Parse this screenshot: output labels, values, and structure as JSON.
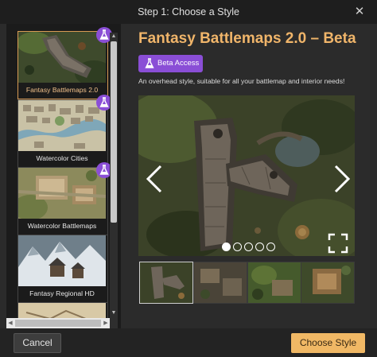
{
  "window": {
    "title": "Step 1: Choose a Style",
    "close_label": "✕"
  },
  "styles": [
    {
      "label": "Fantasy Battlemaps 2.0",
      "beta": true,
      "selected": true
    },
    {
      "label": "Watercolor Cities",
      "beta": true,
      "selected": false
    },
    {
      "label": "Watercolor Battlemaps",
      "beta": true,
      "selected": false
    },
    {
      "label": "Fantasy Regional HD",
      "beta": false,
      "selected": false
    }
  ],
  "detail": {
    "title": "Fantasy Battlemaps 2.0 – Beta",
    "badge_label": "Beta Access",
    "description": "An overhead style, suitable for all your battlemap and interior needs!"
  },
  "carousel": {
    "slide_count": 5,
    "active_slide": 1,
    "thumbnail_count": 4
  },
  "footer": {
    "cancel_label": "Cancel",
    "choose_label": "Choose Style"
  },
  "colors": {
    "accent": "#f0b56a",
    "beta_purple": "#8a4ed6",
    "button_gold": "#f0b865"
  }
}
